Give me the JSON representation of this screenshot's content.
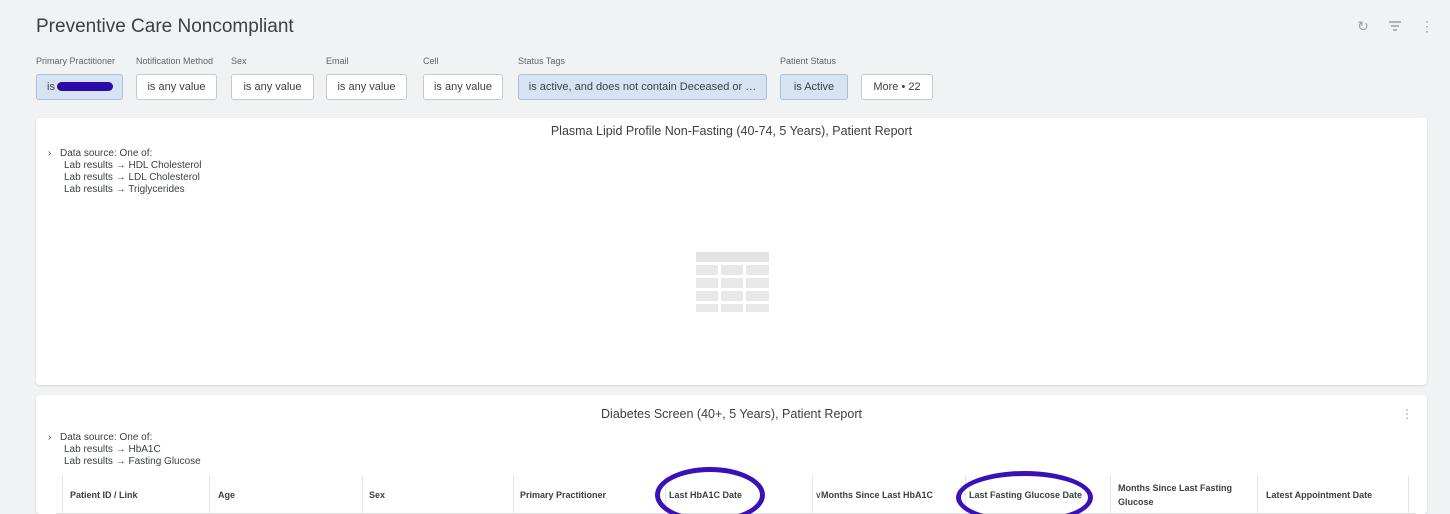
{
  "header": {
    "title": "Preventive Care Noncompliant",
    "icons": [
      "refresh-icon",
      "filter-icon",
      "more-vert-icon"
    ]
  },
  "filters": [
    {
      "label": "Primary Practitioner",
      "value": "is",
      "redacted": true
    },
    {
      "label": "Notification Method",
      "value": "is any value"
    },
    {
      "label": "Sex",
      "value": "is any value"
    },
    {
      "label": "Email",
      "value": "is any value"
    },
    {
      "label": "Cell",
      "value": "is any value"
    },
    {
      "label": "Status Tags",
      "value": "is active, and does not contain Deceased or …"
    },
    {
      "label": "Patient Status",
      "value": "is Active"
    },
    {
      "label": "",
      "value": "More • 22"
    }
  ],
  "cards": [
    {
      "title": "Plasma Lipid Profile Non-Fasting (40-74, 5 Years), Patient Report",
      "source_label": "Data source: One of:",
      "sources": [
        "Lab results → HDL Cholesterol",
        "Lab results → LDL Cholesterol",
        "Lab results → Triglycerides"
      ]
    },
    {
      "title": "Diabetes Screen (40+, 5 Years), Patient Report",
      "source_label": "Data source: One of:",
      "sources": [
        "Lab results → HbA1C",
        "Lab results → Fasting Glucose"
      ],
      "columns": [
        "Patient ID / Link",
        "Age",
        "Sex",
        "Primary Practitioner",
        "Last HbA1C Date",
        "Months Since Last HbA1C",
        "Last Fasting Glucose Date",
        "Months Since Last Fasting Glucose",
        "Latest Appointment Date"
      ]
    }
  ],
  "colors": {
    "annotation": "#3b10b8",
    "redaction": "#2a0aa8",
    "active_filter": "#d7e3f3"
  }
}
